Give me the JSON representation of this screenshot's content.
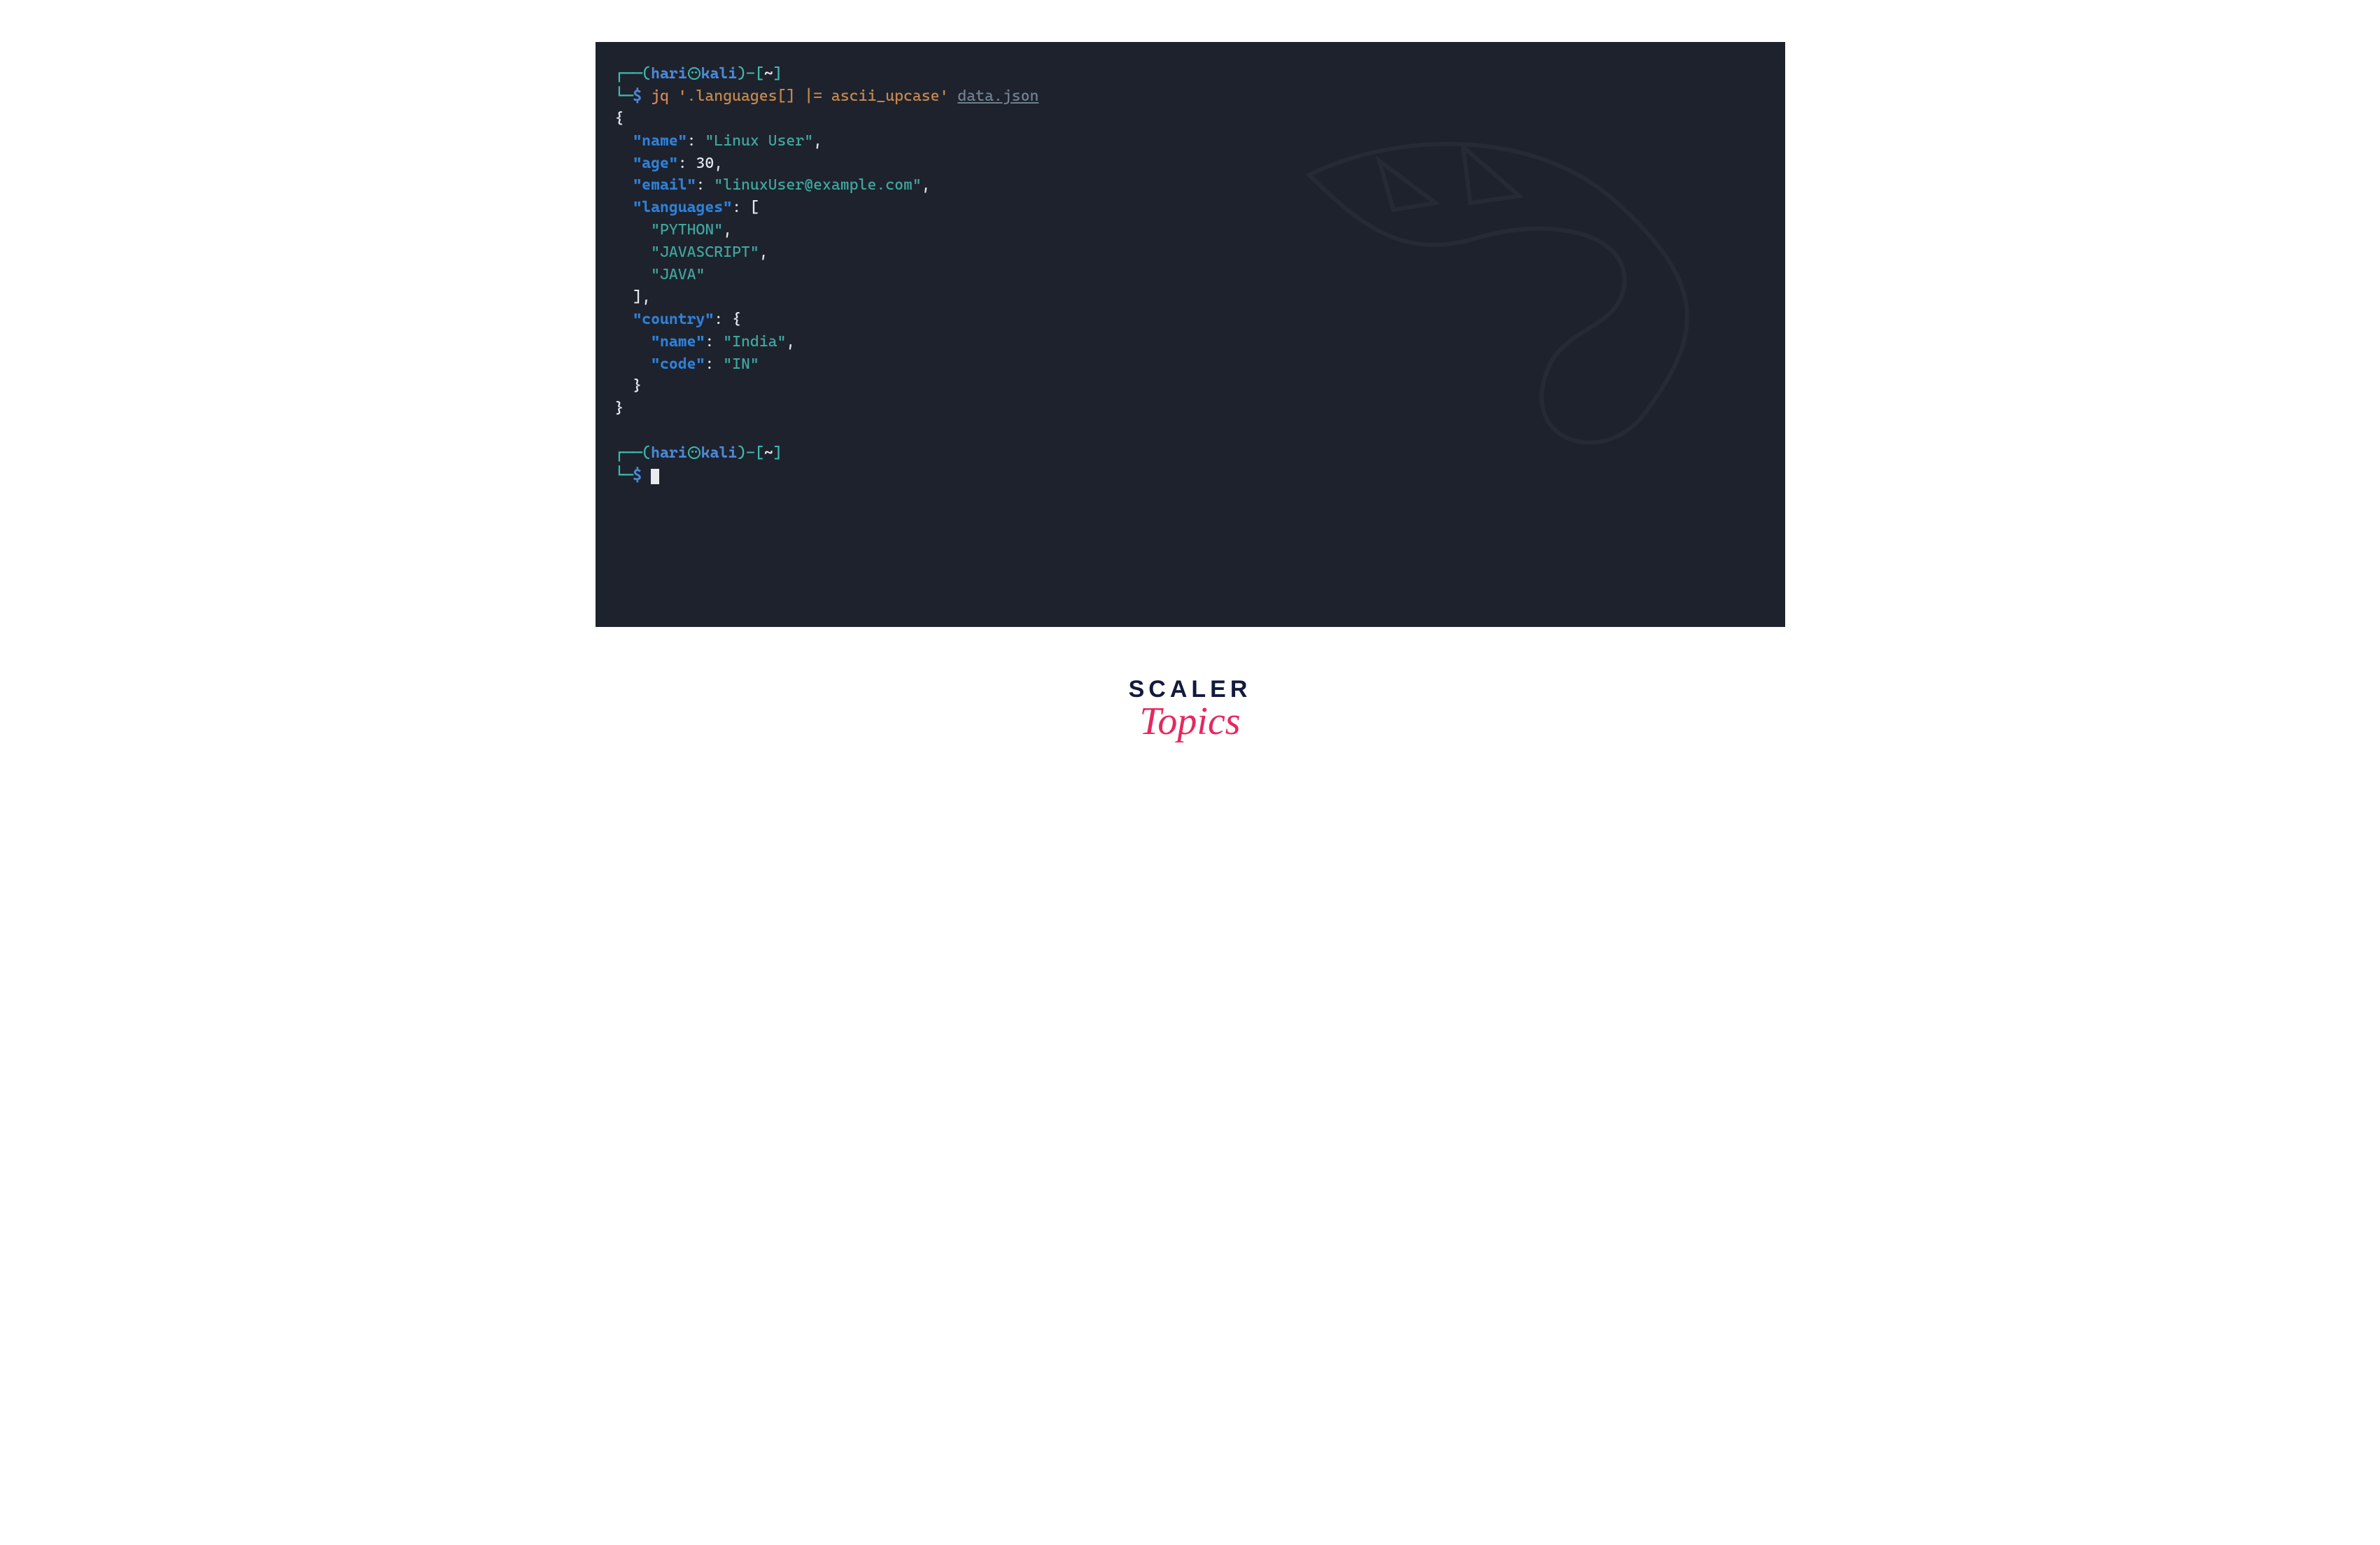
{
  "prompt": {
    "user": "hari",
    "host": "kali",
    "cwd": "~",
    "symbol": "$"
  },
  "command": {
    "bin": "jq",
    "filter": "'.languages[] |= ascii_upcase'",
    "file": "data.json"
  },
  "output": {
    "open": "{",
    "name_key": "\"name\"",
    "name_val": "\"Linux User\"",
    "age_key": "\"age\"",
    "age_val": "30",
    "email_key": "\"email\"",
    "email_val": "\"linuxUser@example.com\"",
    "languages_key": "\"languages\"",
    "lang1": "\"PYTHON\"",
    "lang2": "\"JAVASCRIPT\"",
    "lang3": "\"JAVA\"",
    "country_key": "\"country\"",
    "country_name_key": "\"name\"",
    "country_name_val": "\"India\"",
    "country_code_key": "\"code\"",
    "country_code_val": "\"IN\"",
    "close": "}"
  },
  "branding": {
    "line1": "SCALER",
    "line2": "Topics"
  }
}
